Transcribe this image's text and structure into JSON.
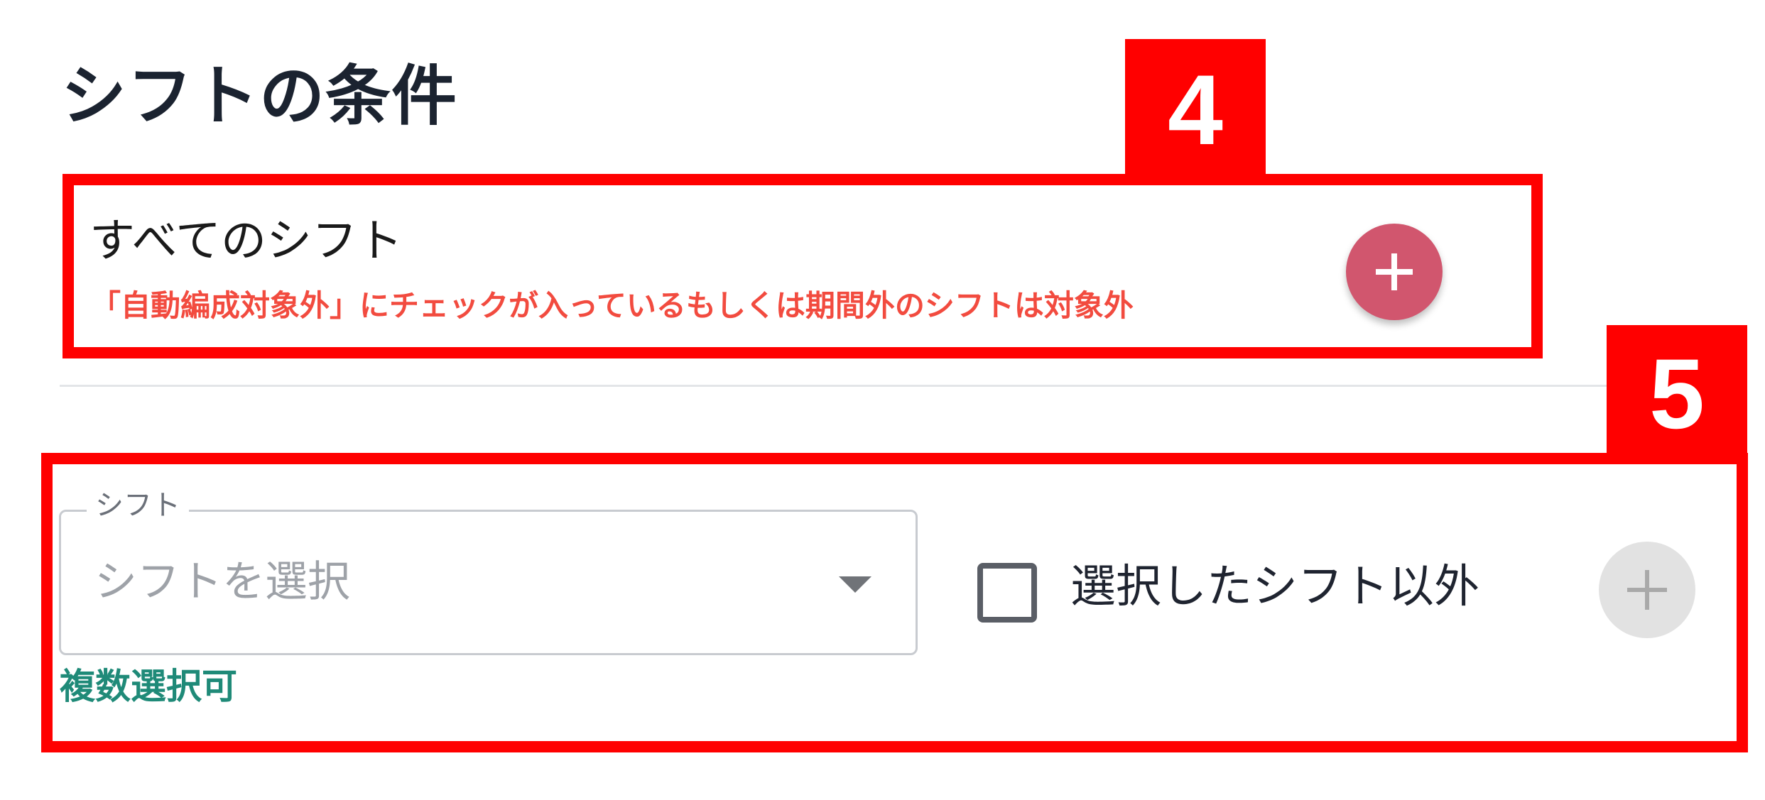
{
  "section": {
    "title": "シフトの条件"
  },
  "annotations": {
    "tag_4": "4",
    "tag_5": "5",
    "color": "#ff0000"
  },
  "all_shifts": {
    "label": "すべてのシフト",
    "note": "「自動編成対象外」にチェックが入っているもしくは期間外のシフトは対象外",
    "note_color": "#f24b3f",
    "add_button_icon": "plus-icon",
    "add_button_color": "#d1566e"
  },
  "shift_condition": {
    "select_label": "シフト",
    "select_placeholder": "シフトを選択",
    "select_helper": "複数選択可",
    "helper_color": "#1f8a78",
    "exclude_checkbox_label": "選択したシフト以外",
    "exclude_checked": false,
    "add_button_icon": "plus-icon",
    "add_button_disabled": true
  }
}
